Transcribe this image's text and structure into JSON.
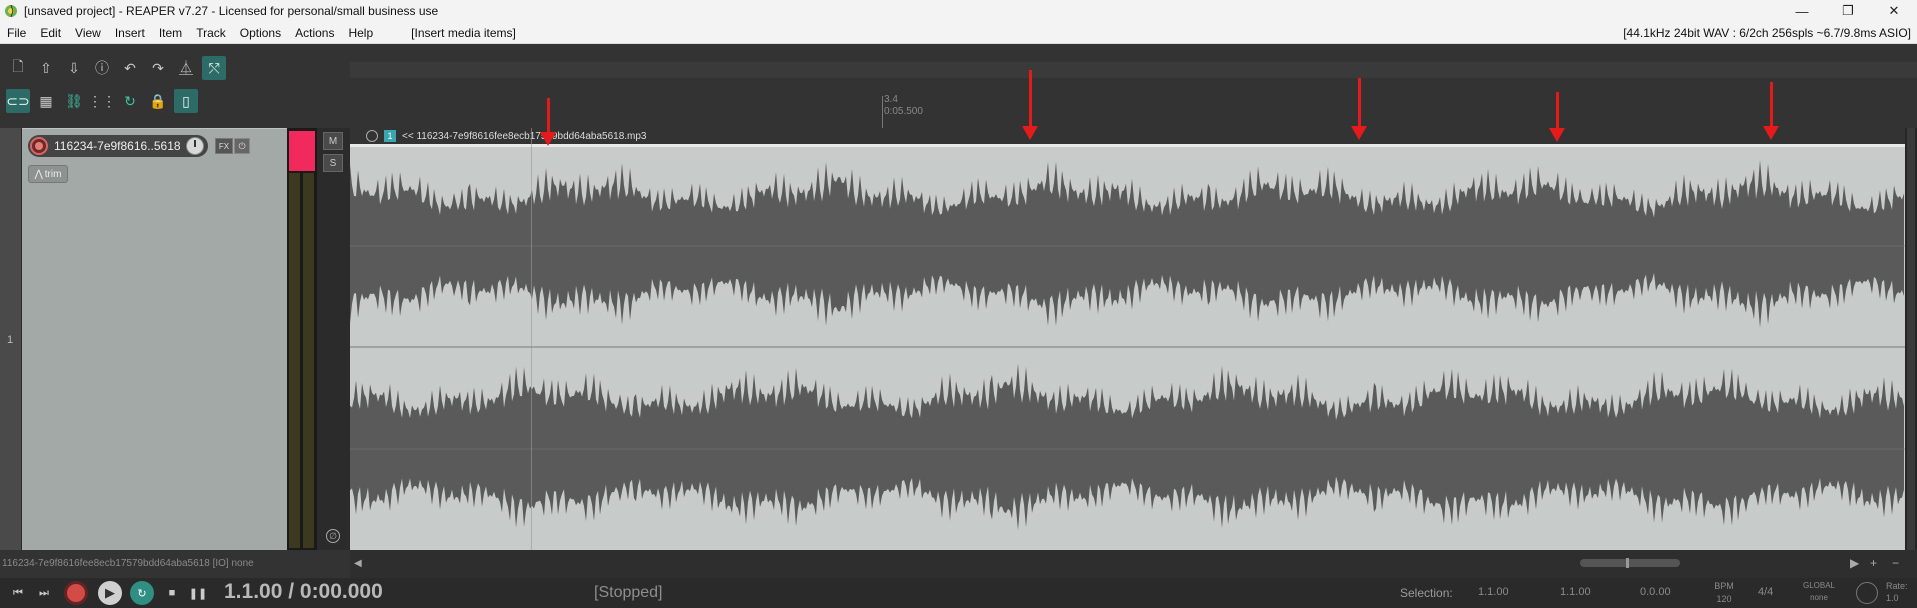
{
  "window": {
    "title": "[unsaved project] - REAPER v7.27 - Licensed for personal/small business use",
    "buttons": {
      "minimize": "—",
      "maximize": "❐",
      "close": "✕"
    }
  },
  "menu": {
    "items": [
      "File",
      "Edit",
      "View",
      "Insert",
      "Item",
      "Track",
      "Options",
      "Actions",
      "Help"
    ],
    "mode": "[Insert media items]",
    "audio_status": "[44.1kHz 24bit WAV : 6/2ch 256spls ~6.7/9.8ms ASIO]"
  },
  "toolbar": {
    "row1": [
      {
        "name": "new-project-icon",
        "glyph": "🗋"
      },
      {
        "name": "open-project-icon",
        "glyph": "⇧"
      },
      {
        "name": "save-project-icon",
        "glyph": "⇩"
      },
      {
        "name": "project-settings-icon",
        "glyph": "ⓘ"
      },
      {
        "name": "undo-icon",
        "glyph": "↶"
      },
      {
        "name": "redo-icon",
        "glyph": "↷"
      },
      {
        "name": "metronome-icon",
        "glyph": "⏅"
      },
      {
        "name": "ripple-edit-icon",
        "glyph": "⤲",
        "active": true
      }
    ],
    "row2": [
      {
        "name": "grouping-icon",
        "glyph": "⊂⊃",
        "active": true
      },
      {
        "name": "grid-icon",
        "glyph": "▦"
      },
      {
        "name": "item-grouping-icon",
        "glyph": "⛓",
        "green": true
      },
      {
        "name": "snap-icon",
        "glyph": "⋮⋮"
      },
      {
        "name": "loop-points-icon",
        "glyph": "↻",
        "green": true
      },
      {
        "name": "lock-icon",
        "glyph": "🔒"
      },
      {
        "name": "envelope-icon",
        "glyph": "▯",
        "active": true
      }
    ]
  },
  "ruler": {
    "marker_bar": "3.4",
    "marker_time": "0:05.500"
  },
  "track": {
    "number": "1",
    "name": "116234-7e9f8616..5618",
    "fx_label": "FX",
    "power_label": "⏻",
    "trim_label": "trim",
    "mute_label": "M",
    "solo_label": "S",
    "phase_label": "∅"
  },
  "item": {
    "take_number": "1",
    "take_name": "<< 116234-7e9f8616fee8ecb17579bdd64aba5618.mp3"
  },
  "status_line": "116234-7e9f8616fee8ecb17579bdd64aba5618 [IO] none",
  "transport": {
    "time": "1.1.00 / 0:00.000",
    "state": "[Stopped]",
    "selection_label": "Selection:",
    "sel_start": "1.1.00",
    "sel_end": "1.1.00",
    "sel_length": "0.0.00",
    "bpm_label": "BPM",
    "bpm_value": "120",
    "time_sig": "4/4",
    "global_label": "GLOBAL",
    "global_value": "none",
    "rate_label": "Rate:",
    "rate_value": "1.0"
  },
  "colors": {
    "accent_teal": "#2d6b66",
    "record_red": "#d24b47",
    "meter_pink": "#f2295c",
    "annotation_red": "#e51b1b",
    "item_bg": "#c7cbc9",
    "waveform": "#5a5a5a"
  }
}
